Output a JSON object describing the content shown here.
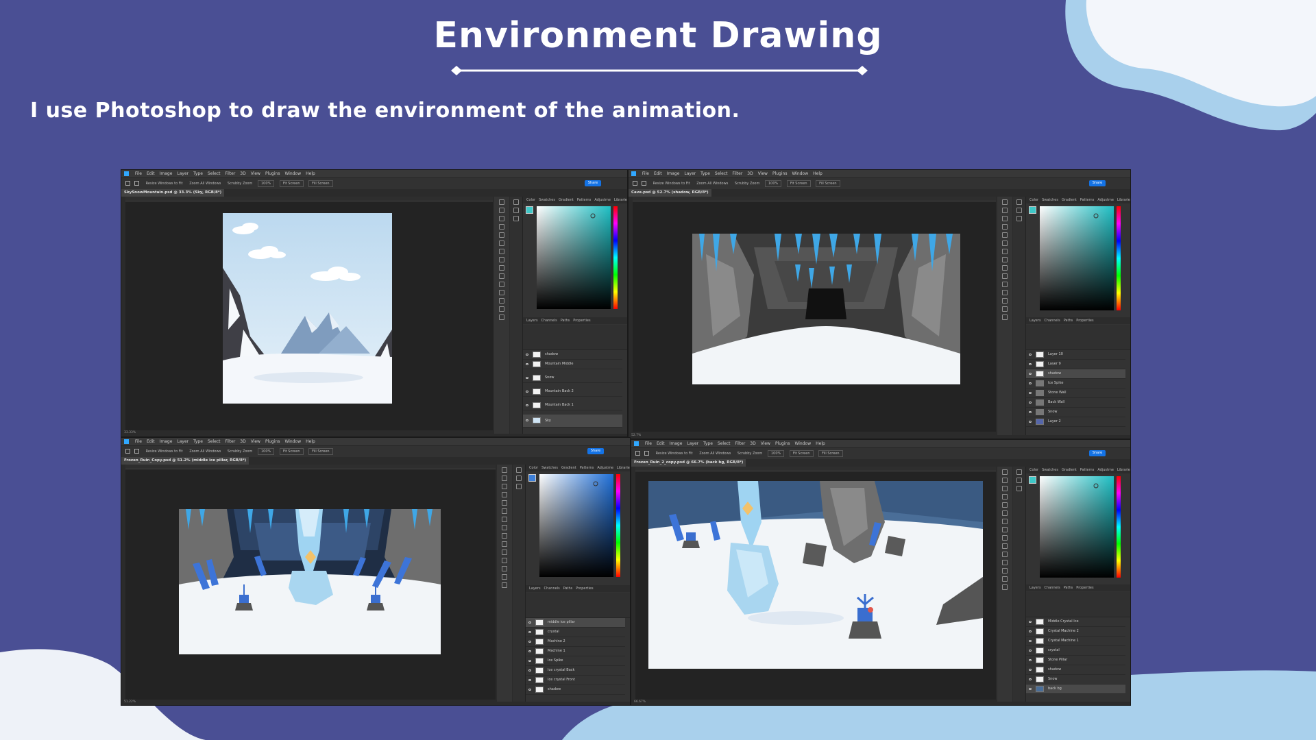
{
  "slide": {
    "title": "Environment Drawing",
    "subtitle": "I use Photoshop to draw the environment of the animation.",
    "colors": {
      "background": "#4a4f94",
      "accent": "#a9d0ec",
      "text": "#ffffff"
    }
  },
  "menu_items": [
    "File",
    "Edit",
    "Image",
    "Layer",
    "Type",
    "Select",
    "Filter",
    "3D",
    "View",
    "Plugins",
    "Window",
    "Help"
  ],
  "options_bar": {
    "resize": "Resize Windows to Fit",
    "zoom_all": "Zoom All Windows",
    "scrubby": "Scrubby Zoom",
    "zoom": "100%",
    "fit": "Fit Screen",
    "fill": "Fill Screen",
    "share": "Share"
  },
  "panel_tabs": {
    "color": [
      "Color",
      "Swatches",
      "Gradient",
      "Patterns",
      "Adjustme",
      "Libraries"
    ],
    "layers": [
      "Layers",
      "Channels",
      "Paths",
      "Properties"
    ]
  },
  "windows": [
    {
      "doc_tab": "SkySnowMountain.psd @ 33.3% (Sky, RGB/8*)",
      "status": "33.33%",
      "layers": [
        {
          "name": "shadow",
          "selected": false
        },
        {
          "name": "Mountain Middle",
          "selected": false
        },
        {
          "name": "Snow",
          "selected": false
        },
        {
          "name": "Mountain Back 2",
          "selected": false
        },
        {
          "name": "Mountain Back 1",
          "selected": false
        },
        {
          "name": "Sky",
          "selected": true
        }
      ]
    },
    {
      "doc_tab": "Cave.psd @ 52.7% (shadow, RGB/8*)",
      "status": "52.7%",
      "layers": [
        {
          "name": "Layer 10",
          "selected": false
        },
        {
          "name": "Layer 9",
          "selected": false
        },
        {
          "name": "shadow",
          "selected": true
        },
        {
          "name": "Ice Spike",
          "selected": false
        },
        {
          "name": "Stone Wall",
          "selected": false
        },
        {
          "name": "Back Wall",
          "selected": false
        },
        {
          "name": "Snow",
          "selected": false
        },
        {
          "name": "Layer 2",
          "selected": false
        }
      ]
    },
    {
      "doc_tab": "Frozen_Ruin_Copy.psd @ 51.2% (middle ice pillar, RGB/8*)",
      "status": "51.22%",
      "layers": [
        {
          "name": "middle ice pillar",
          "selected": true
        },
        {
          "name": "crystal",
          "selected": false
        },
        {
          "name": "Machine 2",
          "selected": false
        },
        {
          "name": "Machine 1",
          "selected": false
        },
        {
          "name": "Ice Spike",
          "selected": false
        },
        {
          "name": "Ice crystal Back",
          "selected": false
        },
        {
          "name": "Ice crystal Front",
          "selected": false
        },
        {
          "name": "shadow",
          "selected": false
        }
      ]
    },
    {
      "doc_tab": "Frozen_Ruin_2_copy.psd @ 66.7% (back bg, RGB/8*)",
      "status": "66.67%",
      "layers": [
        {
          "name": "Middle Crystal Ice",
          "selected": false
        },
        {
          "name": "Crystal Machine 2",
          "selected": false
        },
        {
          "name": "Crystal Machine 1",
          "selected": false
        },
        {
          "name": "crystal",
          "selected": false
        },
        {
          "name": "Stone Pillar",
          "selected": false
        },
        {
          "name": "shadow",
          "selected": false
        },
        {
          "name": "Snow",
          "selected": false
        },
        {
          "name": "back bg",
          "selected": true
        }
      ]
    }
  ]
}
